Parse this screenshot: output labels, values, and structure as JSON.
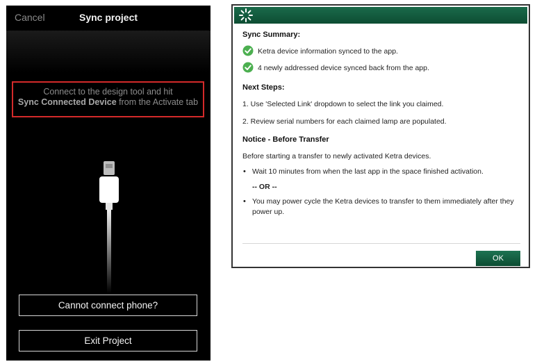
{
  "phone": {
    "cancel_label": "Cancel",
    "title": "Sync project",
    "instruction_line1": "Connect to the design tool and hit",
    "instruction_bold": "Sync Connected Device",
    "instruction_rest": " from the Activate tab",
    "cannot_connect_label": "Cannot connect phone?",
    "exit_label": "Exit Project"
  },
  "dialog": {
    "logo_icon": "ketra-logo-icon",
    "sync_summary_heading": "Sync Summary:",
    "summary_items": [
      "Ketra device information synced to the app.",
      "4 newly addressed device synced back from the app."
    ],
    "next_steps_heading": "Next Steps:",
    "steps": [
      "1. Use 'Selected Link' dropdown to select the link you claimed.",
      "2. Review serial numbers for each claimed lamp are populated."
    ],
    "notice_heading": "Notice - Before Transfer",
    "notice_intro": "Before starting a transfer to newly activated Ketra devices.",
    "bullet1": "Wait 10 minutes from when the last app in the space finished activation.",
    "or_label": "-- OR --",
    "bullet2": "You may power cycle the Ketra devices to transfer to them immediately after they power up.",
    "ok_label": "OK"
  },
  "colors": {
    "highlight_border": "#d42a2a",
    "dialog_green": "#0d4d33",
    "check_green": "#4caf50"
  }
}
